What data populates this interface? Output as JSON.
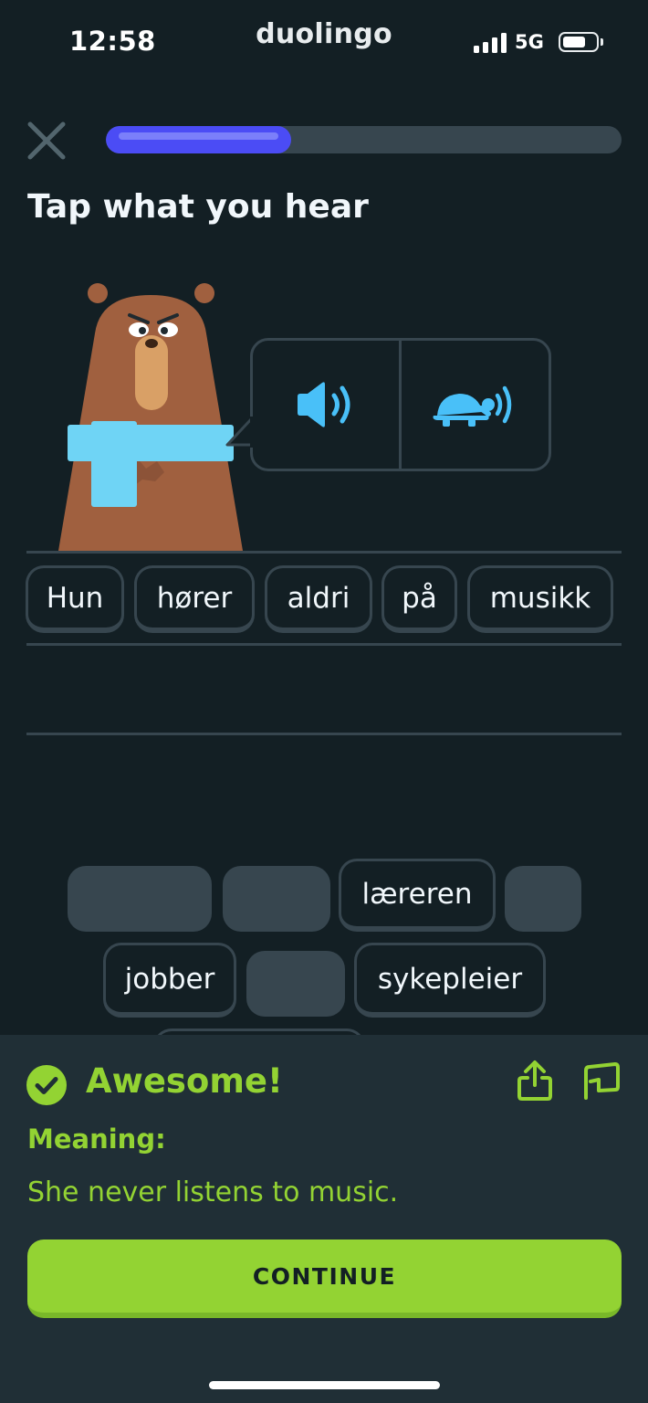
{
  "status_bar": {
    "time": "12:58",
    "carrier": "duolingo",
    "network": "5G"
  },
  "header": {
    "progress": 0.36
  },
  "prompt": "Tap what you hear",
  "audio": {
    "normal_icon": "speaker-icon",
    "slow_icon": "turtle-speaker-icon"
  },
  "answer_words": [
    "Hun",
    "hører",
    "aldri",
    "på",
    "musikk"
  ],
  "word_bank": {
    "row1": [
      "lærerен"
    ],
    "row2": [
      "jobber",
      "sykepleier"
    ]
  },
  "feedback": {
    "title": "Awesome!",
    "meaning_label": "Meaning:",
    "meaning_text": "She never listens to music.",
    "continue_label": "CONTINUE"
  },
  "colors": {
    "success": "#93d333",
    "progress": "#4b4cf5",
    "background": "#131f24",
    "panel": "#202f36"
  }
}
